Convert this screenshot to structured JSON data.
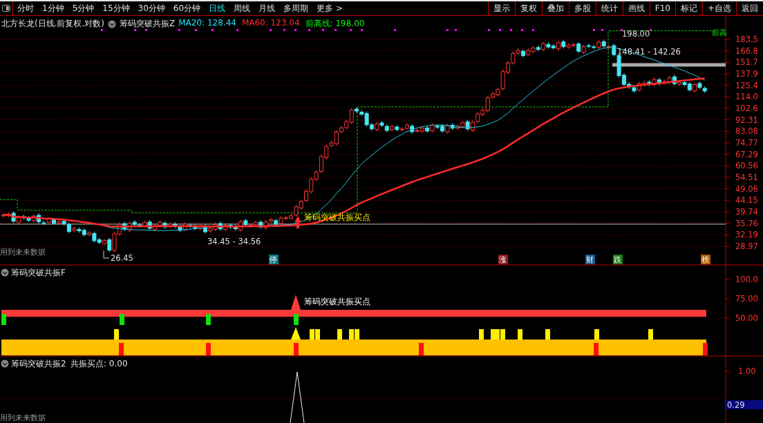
{
  "toolbar": {
    "periods": [
      {
        "label": "分时",
        "selected": false
      },
      {
        "label": "1分钟",
        "selected": false
      },
      {
        "label": "5分钟",
        "selected": false
      },
      {
        "label": "15分钟",
        "selected": false
      },
      {
        "label": "30分钟",
        "selected": false
      },
      {
        "label": "60分钟",
        "selected": false
      },
      {
        "label": "日线",
        "selected": true
      },
      {
        "label": "周线",
        "selected": false
      },
      {
        "label": "月线",
        "selected": false
      },
      {
        "label": "多周期",
        "selected": false
      },
      {
        "label": "更多 >",
        "selected": false
      }
    ],
    "buttons": [
      "显示",
      "复权",
      "叠加",
      "多股",
      "统计",
      "画线",
      "F10",
      "标记",
      "+自选",
      "返回"
    ]
  },
  "main_chart": {
    "title": "北方长龙(日线.前复权.对数)",
    "indicator": "筹码突破共振Z",
    "legend": [
      {
        "text": "MA20: 128.44",
        "color": "#22e0f0"
      },
      {
        "text": "MA60: 123.04",
        "color": "#ff2a2a"
      },
      {
        "text": "前高线: 198.00",
        "color": "#10f010"
      }
    ],
    "price_axis": [
      "183.5",
      "166.8",
      "151.7",
      "137.9",
      "125.4",
      "114.0",
      "102.6",
      "92.31",
      "83.08",
      "74.77",
      "67.29",
      "60.56",
      "54.51",
      "49.06",
      "44.15",
      "39.74",
      "35.76",
      "32.19",
      "28.97"
    ],
    "labels": [
      "198.00",
      "148.41 - 142.26",
      "34.45 - 34.56",
      "26.45"
    ],
    "corner_label": "前高",
    "signal_label": "筹码突破共振买点",
    "warning": "用到未来数据",
    "events": [
      {
        "text": "停",
        "color": "#0a7a80"
      },
      {
        "text": "涨",
        "color": "#8a1a1a"
      },
      {
        "text": "财",
        "color": "#1a5a90"
      },
      {
        "text": "跌",
        "color": "#1a7a1a"
      },
      {
        "text": "榜",
        "color": "#b05a00"
      }
    ]
  },
  "panel_f": {
    "title": "筹码突破共振F",
    "axis": [
      "100.0",
      "75.00",
      "50.00"
    ],
    "signal_label": "筹码突破共振买点"
  },
  "panel_2": {
    "title": "筹码突破共振2",
    "reading": "共振买点: 0.00",
    "axis": [
      "1.00"
    ],
    "current": "0.29",
    "warning": "用到未来数据"
  }
}
